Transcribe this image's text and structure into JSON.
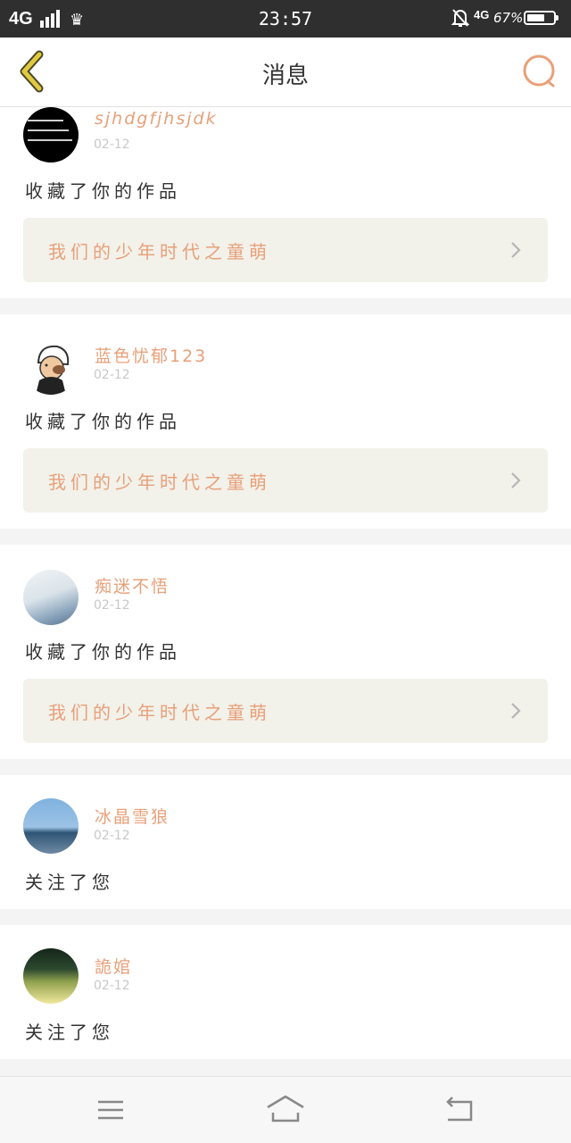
{
  "status_bar": {
    "signal_label": "4G",
    "time": "23:57",
    "network_label": "4G",
    "battery_percent": "67%",
    "battery_level": 0.67,
    "icons": [
      "signal-bars-icon",
      "crown-icon",
      "bell-muted-icon",
      "battery-icon"
    ]
  },
  "header": {
    "title": "消息",
    "back_icon": "chevron-left-icon",
    "search_icon": "search-icon",
    "accent_color": "#e8a079",
    "back_color": "#d8c23c"
  },
  "messages": [
    {
      "username": "sjhdgfjhsjdk",
      "date": "02-12",
      "action": "收藏了你的作品",
      "work_title": "我们的少年时代之童萌"
    },
    {
      "username": "蓝色忧郁123",
      "date": "02-12",
      "action": "收藏了你的作品",
      "work_title": "我们的少年时代之童萌"
    },
    {
      "username": "痴迷不悟",
      "date": "02-12",
      "action": "收藏了你的作品",
      "work_title": "我们的少年时代之童萌"
    },
    {
      "username": "冰晶雪狼",
      "date": "02-12",
      "action": "关注了您"
    },
    {
      "username": "詭婠",
      "date": "02-12",
      "action": "关注了您"
    }
  ],
  "system_nav": {
    "icons": [
      "menu-icon",
      "home-icon",
      "back-arrow-icon"
    ]
  }
}
